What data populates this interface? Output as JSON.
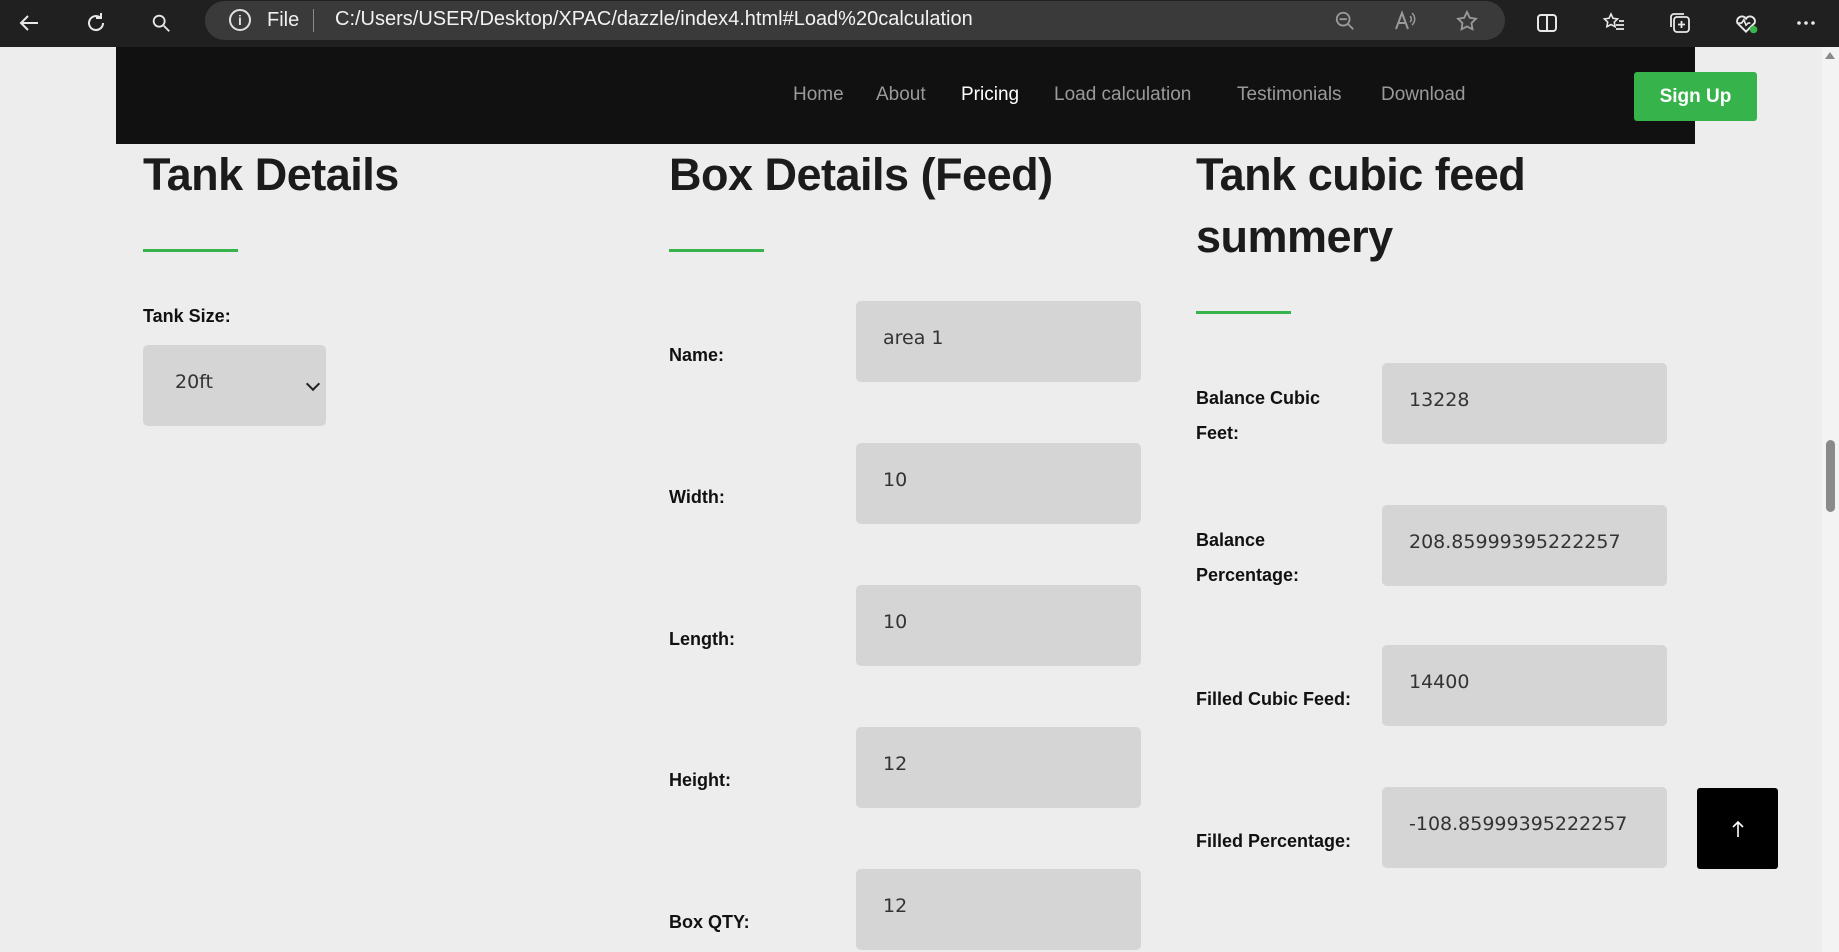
{
  "browser": {
    "address": {
      "scheme_label": "File",
      "url": "C:/Users/USER/Desktop/XPAC/dazzle/index4.html#Load%20calculation"
    }
  },
  "site_nav": {
    "links": [
      "Home",
      "About",
      "Pricing",
      "Load calculation",
      "Testimonials",
      "Download"
    ],
    "active": "Pricing",
    "signup_label": "Sign Up",
    "accent_color": "#36b34a"
  },
  "tank_details": {
    "title": "Tank Details",
    "tank_size_label": "Tank Size:",
    "tank_size_value": "20ft"
  },
  "box_details": {
    "title": "Box Details (Feed)",
    "fields": [
      {
        "label": "Name:",
        "value": "area 1"
      },
      {
        "label": "Width:",
        "value": "10"
      },
      {
        "label": "Length:",
        "value": "10"
      },
      {
        "label": "Height:",
        "value": "12"
      },
      {
        "label": "Box QTY:",
        "value": "12"
      }
    ]
  },
  "summary": {
    "title_line1": "Tank cubic feed",
    "title_line2": "summery",
    "fields": [
      {
        "label_line1": "Balance Cubic",
        "label_line2": "Feet:",
        "value": "13228"
      },
      {
        "label_line1": "Balance",
        "label_line2": "Percentage:",
        "value": "208.85999395222257"
      },
      {
        "label_line1": "Filled Cubic Feed:",
        "label_line2": "",
        "value": "14400"
      },
      {
        "label_line1": "Filled Percentage:",
        "label_line2": "",
        "value": "-108.85999395222257"
      }
    ]
  },
  "back_to_top": {
    "icon": "arrow-up-icon"
  }
}
